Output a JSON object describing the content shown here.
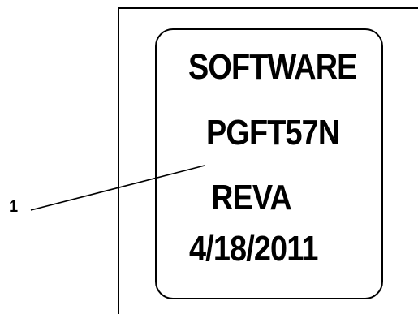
{
  "label": {
    "lines": [
      "SOFTWARE",
      "PGFT57N",
      "REVA",
      "4/18/2011"
    ]
  },
  "callouts": [
    {
      "number": "1"
    }
  ]
}
